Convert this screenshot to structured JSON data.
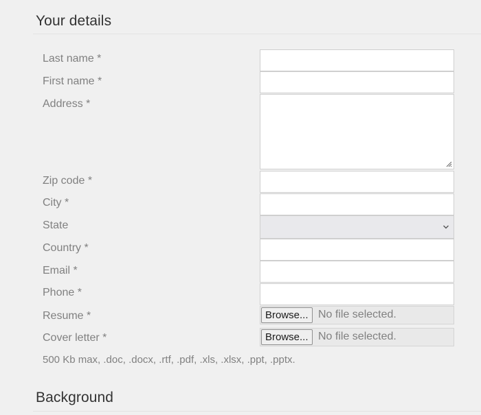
{
  "sections": {
    "details_title": "Your details",
    "background_title": "Background"
  },
  "fields": {
    "last_name": {
      "label": "Last name *",
      "value": ""
    },
    "first_name": {
      "label": "First name *",
      "value": ""
    },
    "address": {
      "label": "Address *",
      "value": ""
    },
    "zip_code": {
      "label": "Zip code *",
      "value": ""
    },
    "city": {
      "label": "City *",
      "value": ""
    },
    "state": {
      "label": "State",
      "selected": ""
    },
    "country": {
      "label": "Country *",
      "value": ""
    },
    "email": {
      "label": "Email *",
      "value": ""
    },
    "phone": {
      "label": "Phone *",
      "value": ""
    },
    "resume": {
      "label": "Resume *",
      "button": "Browse...",
      "status": "No file selected."
    },
    "cover_letter": {
      "label": "Cover letter *",
      "button": "Browse...",
      "status": "No file selected."
    }
  },
  "file_hint": "500 Kb max, .doc, .docx, .rtf, .pdf, .xls, .xlsx, .ppt, .pptx.",
  "icons": {
    "state_dropdown": "chevron-down-icon",
    "address_resize": "resize-grip-icon"
  },
  "colors": {
    "background": "#f0f0f0",
    "title": "#333333",
    "label": "#808080",
    "input_background": "#ffffff",
    "select_background": "#e9e9ec"
  }
}
